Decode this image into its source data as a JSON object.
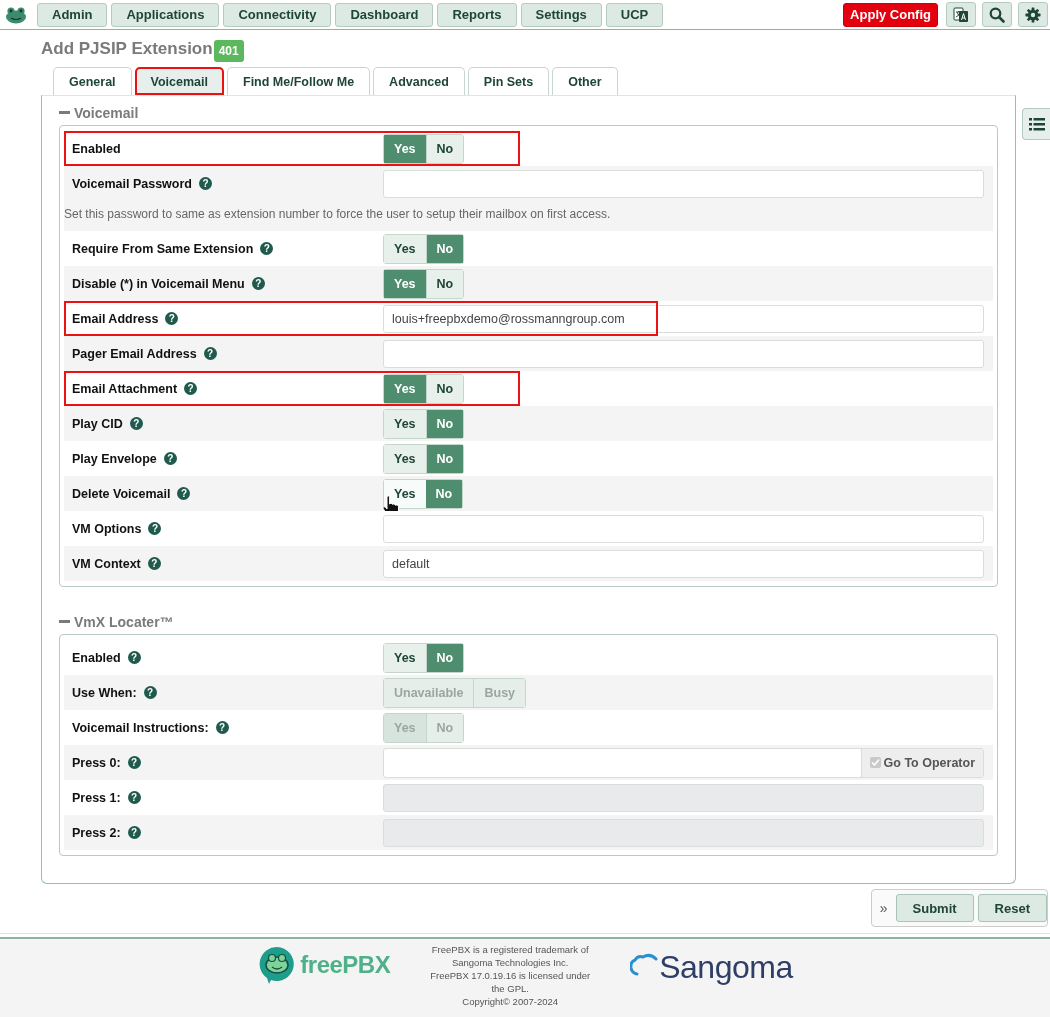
{
  "topbar": {
    "nav": [
      {
        "label": "Admin"
      },
      {
        "label": "Applications"
      },
      {
        "label": "Connectivity"
      },
      {
        "label": "Dashboard"
      },
      {
        "label": "Reports"
      },
      {
        "label": "Settings"
      },
      {
        "label": "UCP"
      }
    ],
    "apply_button": "Apply Config"
  },
  "page": {
    "title": "Add PJSIP Extension",
    "badge": "401"
  },
  "tabs": [
    {
      "label": "General",
      "selected": false,
      "highlighted": false
    },
    {
      "label": "Voicemail",
      "selected": true,
      "highlighted": true
    },
    {
      "label": "Find Me/Follow Me",
      "selected": false,
      "highlighted": false
    },
    {
      "label": "Advanced",
      "selected": false,
      "highlighted": false
    },
    {
      "label": "Pin Sets",
      "selected": false,
      "highlighted": false
    },
    {
      "label": "Other",
      "selected": false,
      "highlighted": false
    }
  ],
  "sections": [
    {
      "title": "Voicemail",
      "rows": [
        {
          "kind": "toggle",
          "label": "Enabled",
          "highlighted": true,
          "disabled": false,
          "options": [
            {
              "label": "Yes",
              "selected": true,
              "hovered": false
            },
            {
              "label": "No",
              "selected": false,
              "hovered": false
            }
          ]
        },
        {
          "kind": "input",
          "label": "Voicemail Password",
          "help": "?",
          "highlighted": false,
          "disabled": false,
          "value": "",
          "note": "Set this password to same as extension number to force the user to setup their mailbox on first access."
        },
        {
          "kind": "toggle",
          "label": "Require From Same Extension",
          "help": "?",
          "highlighted": false,
          "disabled": false,
          "options": [
            {
              "label": "Yes",
              "selected": false,
              "hovered": false
            },
            {
              "label": "No",
              "selected": true,
              "hovered": false
            }
          ]
        },
        {
          "kind": "toggle",
          "label": "Disable (*) in Voicemail Menu",
          "help": "?",
          "highlighted": false,
          "disabled": false,
          "options": [
            {
              "label": "Yes",
              "selected": true,
              "hovered": false
            },
            {
              "label": "No",
              "selected": false,
              "hovered": false
            }
          ]
        },
        {
          "kind": "input",
          "label": "Email Address",
          "help": "?",
          "highlighted": true,
          "disabled": false,
          "value": "louis+freepbxdemo@rossmanngroup.com"
        },
        {
          "kind": "input",
          "label": "Pager Email Address",
          "help": "?",
          "highlighted": false,
          "disabled": false,
          "value": ""
        },
        {
          "kind": "toggle",
          "label": "Email Attachment",
          "help": "?",
          "highlighted": true,
          "disabled": false,
          "options": [
            {
              "label": "Yes",
              "selected": true,
              "hovered": false
            },
            {
              "label": "No",
              "selected": false,
              "hovered": false
            }
          ]
        },
        {
          "kind": "toggle",
          "label": "Play CID",
          "help": "?",
          "highlighted": false,
          "disabled": false,
          "options": [
            {
              "label": "Yes",
              "selected": false,
              "hovered": false
            },
            {
              "label": "No",
              "selected": true,
              "hovered": false
            }
          ]
        },
        {
          "kind": "toggle",
          "label": "Play Envelope",
          "help": "?",
          "highlighted": false,
          "disabled": false,
          "options": [
            {
              "label": "Yes",
              "selected": false,
              "hovered": false
            },
            {
              "label": "No",
              "selected": true,
              "hovered": false
            }
          ]
        },
        {
          "kind": "toggle",
          "label": "Delete Voicemail",
          "help": "?",
          "highlighted": false,
          "disabled": false,
          "options": [
            {
              "label": "Yes",
              "selected": false,
              "hovered": true
            },
            {
              "label": "No",
              "selected": true,
              "hovered": false
            }
          ]
        },
        {
          "kind": "input",
          "label": "VM Options",
          "help": "?",
          "highlighted": false,
          "disabled": false,
          "value": ""
        },
        {
          "kind": "input",
          "label": "VM Context",
          "help": "?",
          "highlighted": false,
          "disabled": false,
          "value": "default"
        }
      ]
    },
    {
      "title": "VmX Locater™",
      "rows": [
        {
          "kind": "toggle",
          "label": "Enabled",
          "help": "?",
          "highlighted": false,
          "disabled": false,
          "options": [
            {
              "label": "Yes",
              "selected": false,
              "hovered": false
            },
            {
              "label": "No",
              "selected": true,
              "hovered": false
            }
          ]
        },
        {
          "kind": "toggle",
          "label": "Use When:",
          "help": "?",
          "highlighted": false,
          "disabled": true,
          "options": [
            {
              "label": "Unavailable",
              "selected": false,
              "hovered": false
            },
            {
              "label": "Busy",
              "selected": false,
              "hovered": false
            }
          ]
        },
        {
          "kind": "toggle",
          "label": "Voicemail Instructions:",
          "help": "?",
          "highlighted": false,
          "disabled": true,
          "options": [
            {
              "label": "Yes",
              "selected": true,
              "hovered": false
            },
            {
              "label": "No",
              "selected": false,
              "hovered": false
            }
          ]
        },
        {
          "kind": "input",
          "label": "Press 0:",
          "help": "?",
          "highlighted": false,
          "disabled": false,
          "value": "",
          "addon": {
            "label": "Go To Operator",
            "checked": true
          }
        },
        {
          "kind": "input",
          "label": "Press 1:",
          "help": "?",
          "highlighted": false,
          "disabled": true,
          "value": ""
        },
        {
          "kind": "input",
          "label": "Press 2:",
          "help": "?",
          "highlighted": false,
          "disabled": true,
          "value": ""
        }
      ]
    }
  ],
  "actions": {
    "expand": "»",
    "buttons": [
      {
        "label": "Submit"
      },
      {
        "label": "Reset"
      }
    ]
  },
  "footer": {
    "left_logo": "freePBX",
    "text": [
      "FreePBX is a registered trademark of Sangoma Technologies Inc.",
      "FreePBX 17.0.19.16 is licensed under the GPL.",
      "Copyright© 2007-2024"
    ],
    "right_logo": "Sangoma"
  }
}
